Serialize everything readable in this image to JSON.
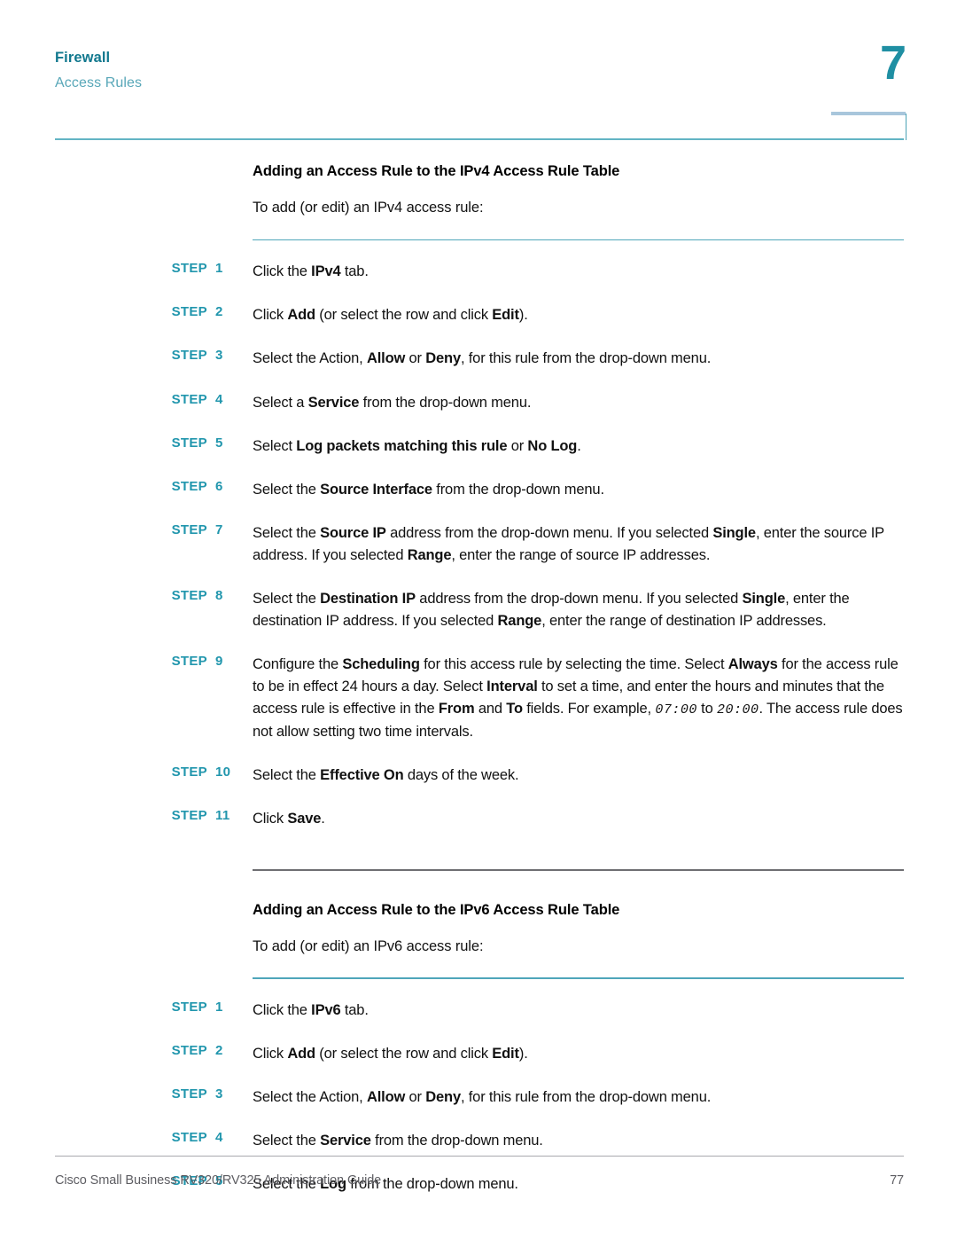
{
  "header": {
    "chapter_title": "Firewall",
    "section_title": "Access Rules",
    "chapter_number": "7"
  },
  "sections": [
    {
      "heading": "Adding an Access Rule to the IPv4 Access Rule Table",
      "intro": "To add (or edit) an IPv4 access rule:",
      "steps": [
        {
          "label": "STEP",
          "num": "1",
          "text": "Click the IPv4 tab."
        },
        {
          "label": "STEP",
          "num": "2",
          "text": "Click Add (or select the row and click Edit)."
        },
        {
          "label": "STEP",
          "num": "3",
          "text": "Select the Action, Allow or Deny, for this rule from the drop-down menu."
        },
        {
          "label": "STEP",
          "num": "4",
          "text": "Select a Service from the drop-down menu."
        },
        {
          "label": "STEP",
          "num": "5",
          "text": "Select Log packets matching this rule or No Log."
        },
        {
          "label": "STEP",
          "num": "6",
          "text": "Select the Source Interface from the drop-down menu."
        },
        {
          "label": "STEP",
          "num": "7",
          "text": "Select the Source IP address from the drop-down menu. If you selected Single, enter the source IP address. If you selected Range, enter the range of source IP addresses."
        },
        {
          "label": "STEP",
          "num": "8",
          "text": "Select the Destination IP address from the drop-down menu. If you selected Single, enter the destination IP address. If you selected Range, enter the range of destination IP addresses."
        },
        {
          "label": "STEP",
          "num": "9",
          "text": "Configure the Scheduling for this access rule by selecting the time. Select Always for the access rule to be in effect 24 hours a day. Select Interval to set a time, and enter the hours and minutes that the access rule is effective in the From and To fields. For example, 07:00 to 20:00. The access rule does not allow setting two time intervals."
        },
        {
          "label": "STEP",
          "num": "10",
          "text": "Select the Effective On days of the week."
        },
        {
          "label": "STEP",
          "num": "11",
          "text": "Click Save."
        }
      ]
    },
    {
      "heading": "Adding an Access Rule to the IPv6 Access Rule Table",
      "intro": "To add (or edit) an IPv6 access rule:",
      "steps": [
        {
          "label": "STEP",
          "num": "1",
          "text": "Click the IPv6 tab."
        },
        {
          "label": "STEP",
          "num": "2",
          "text": "Click Add (or select the row and click Edit)."
        },
        {
          "label": "STEP",
          "num": "3",
          "text": "Select the Action, Allow or Deny, for this rule from the drop-down menu."
        },
        {
          "label": "STEP",
          "num": "4",
          "text": "Select the Service from the drop-down menu."
        },
        {
          "label": "STEP",
          "num": "5",
          "text": "Select the Log from the drop-down menu."
        }
      ]
    }
  ],
  "footer": {
    "document_title": "Cisco Small Business RV320/RV325 Administration Guide",
    "page_number": "77"
  },
  "colors": {
    "chapter_teal": "#11788E",
    "section_teal": "#58A7B8",
    "chapter_number_teal": "#1F8FA3",
    "step_label_teal": "#2196AD",
    "rule_teal": "#4FA6BA",
    "rule_gray": "#6E6E72",
    "tab_blue": "#A8C6DC",
    "body_black": "#111111",
    "footer_gray": "#5D5D62"
  }
}
